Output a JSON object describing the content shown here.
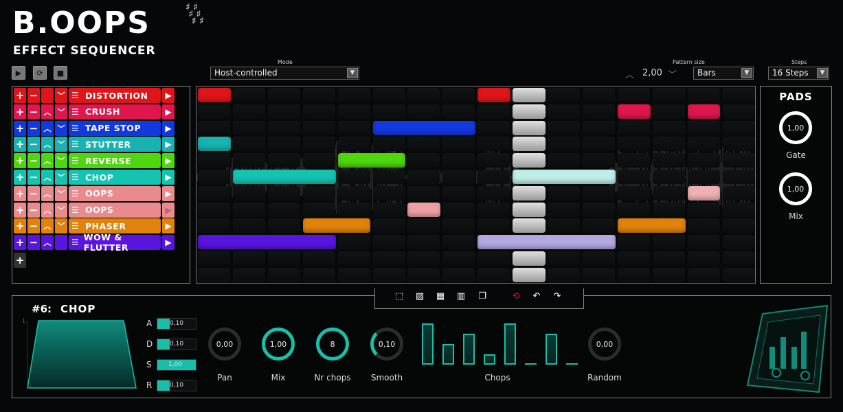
{
  "app": {
    "logo": "B.OOPS",
    "subtitle": "EFFECT SEQUENCER",
    "sharps": "♯♯\n♯♯\n  ♯♯"
  },
  "transport": {
    "play_icon": "play-icon",
    "loop_icon": "loop-icon",
    "stop_icon": "stop-icon"
  },
  "mode": {
    "label": "Mode",
    "value": "Host-controlled"
  },
  "pattern_size": {
    "label": "Pattern  size",
    "value": "2,00",
    "unit": "Bars"
  },
  "steps": {
    "label": "Steps",
    "value": "16 Steps"
  },
  "colors": {
    "accent": "#18bfa8"
  },
  "effects": [
    {
      "name": "DISTORTION",
      "color": "#e0151a"
    },
    {
      "name": "CRUSH",
      "color": "#e0174f"
    },
    {
      "name": "TAPE STOP",
      "color": "#1238e0"
    },
    {
      "name": "STUTTER",
      "color": "#18b3b0"
    },
    {
      "name": "REVERSE",
      "color": "#4fd60f"
    },
    {
      "name": "CHOP",
      "color": "#14c4b0"
    },
    {
      "name": "OOPS",
      "color": "#e88a8e"
    },
    {
      "name": "OOPS",
      "color": "#e88a8e"
    },
    {
      "name": "PHASER",
      "color": "#e0820c"
    },
    {
      "name": "WOW & FLUTTER",
      "color": "#5a14e0"
    }
  ],
  "add_row": "+",
  "pads": {
    "title": "PADS",
    "gate": {
      "label": "Gate",
      "value": "1,00"
    },
    "mix": {
      "label": "Mix",
      "value": "1,00"
    }
  },
  "detail": {
    "index": "#6:",
    "name": "CHOP",
    "env_top": "1",
    "env_bottom": "0",
    "adsr": [
      {
        "label": "A",
        "value": "0,10",
        "level": 0.3
      },
      {
        "label": "D",
        "value": "0,10",
        "level": 0.3
      },
      {
        "label": "S",
        "value": "1,00",
        "level": 1.0
      },
      {
        "label": "R",
        "value": "0,10",
        "level": 0.3
      }
    ],
    "knobs": [
      {
        "label": "Pan",
        "value": "0,00"
      },
      {
        "label": "Mix",
        "value": "1,00"
      },
      {
        "label": "Nr chops",
        "value": "8"
      },
      {
        "label": "Smooth",
        "value": "0,10"
      }
    ],
    "chops_label": "Chops",
    "chop_levels": [
      1.0,
      0.5,
      0.75,
      0.25,
      1.0,
      0.0,
      0.75,
      0.0
    ],
    "random": {
      "label": "Random",
      "value": "0,00"
    }
  }
}
